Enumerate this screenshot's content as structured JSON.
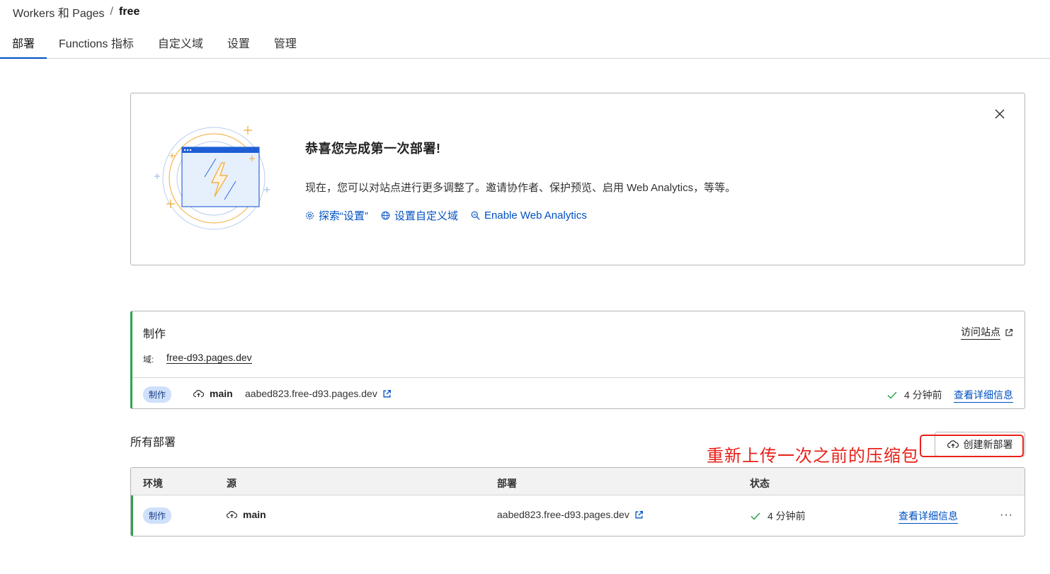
{
  "breadcrumb": {
    "parent": "Workers 和 Pages",
    "separator": "/",
    "current": "free"
  },
  "tabs": [
    {
      "label": "部署"
    },
    {
      "label": "Functions 指标"
    },
    {
      "label": "自定义域"
    },
    {
      "label": "设置"
    },
    {
      "label": "管理"
    }
  ],
  "welcome": {
    "title": "恭喜您完成第一次部署!",
    "description": "现在，您可以对站点进行更多调整了。邀请协作者、保护预览、启用 Web Analytics，等等。",
    "links": [
      {
        "label": "探索“设置”",
        "icon": "gear-icon"
      },
      {
        "label": "设置自定义域",
        "icon": "globe-icon"
      },
      {
        "label": "Enable Web Analytics",
        "icon": "analytics-search-icon"
      }
    ]
  },
  "production": {
    "title": "制作",
    "visit_label": "访问站点",
    "domain_label": "域:",
    "domain": "free-d93.pages.dev",
    "badge": "制作",
    "branch": "main",
    "deploy_url": "aabed823.free-d93.pages.dev",
    "time": "4 分钟前",
    "details_label": "查看详细信息"
  },
  "all_deployments": {
    "title": "所有部署",
    "create_button": "创建新部署",
    "annotation": "重新上传一次之前的压缩包",
    "columns": [
      "环境",
      "源",
      "部署",
      "状态"
    ],
    "rows": [
      {
        "env": "制作",
        "branch": "main",
        "deploy_url": "aabed823.free-d93.pages.dev",
        "time": "4 分钟前",
        "details_label": "查看详细信息",
        "more": "···"
      }
    ]
  },
  "colors": {
    "accent": "#0051c3",
    "success": "#2da44e",
    "annotation": "#e8211a",
    "badge_bg": "#cfe0fb"
  }
}
